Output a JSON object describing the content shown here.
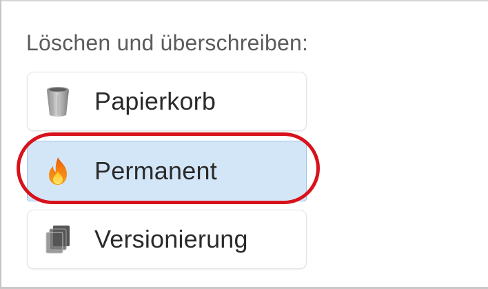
{
  "section": {
    "title": "Löschen und überschreiben:"
  },
  "options": [
    {
      "label": "Papierkorb",
      "icon": "trash-can-icon",
      "selected": false
    },
    {
      "label": "Permanent",
      "icon": "fire-icon",
      "selected": true
    },
    {
      "label": "Versionierung",
      "icon": "stacked-documents-icon",
      "selected": false
    }
  ],
  "colors": {
    "selected_background": "#d3e6f8",
    "highlight_ring": "#d8121b",
    "title_text": "#5b5b5b",
    "label_text": "#2a2a2a"
  }
}
